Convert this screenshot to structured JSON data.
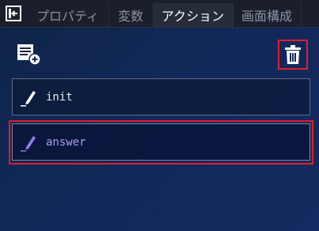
{
  "tabs": {
    "props": "プロパティ",
    "vars": "変数",
    "action": "アクション",
    "layout": "画面構成",
    "active": "action"
  },
  "actions": [
    {
      "label": "init",
      "selected": false
    },
    {
      "label": "answer",
      "selected": true
    }
  ],
  "icons": {
    "collapse": "panel-collapse-icon",
    "add": "add-action-icon",
    "delete": "trash-icon",
    "edit": "pencil-icon"
  },
  "colors": {
    "highlight": "#e11d2a",
    "selected_text": "#a99cf6",
    "selected_pencil": "#8f7df0"
  }
}
